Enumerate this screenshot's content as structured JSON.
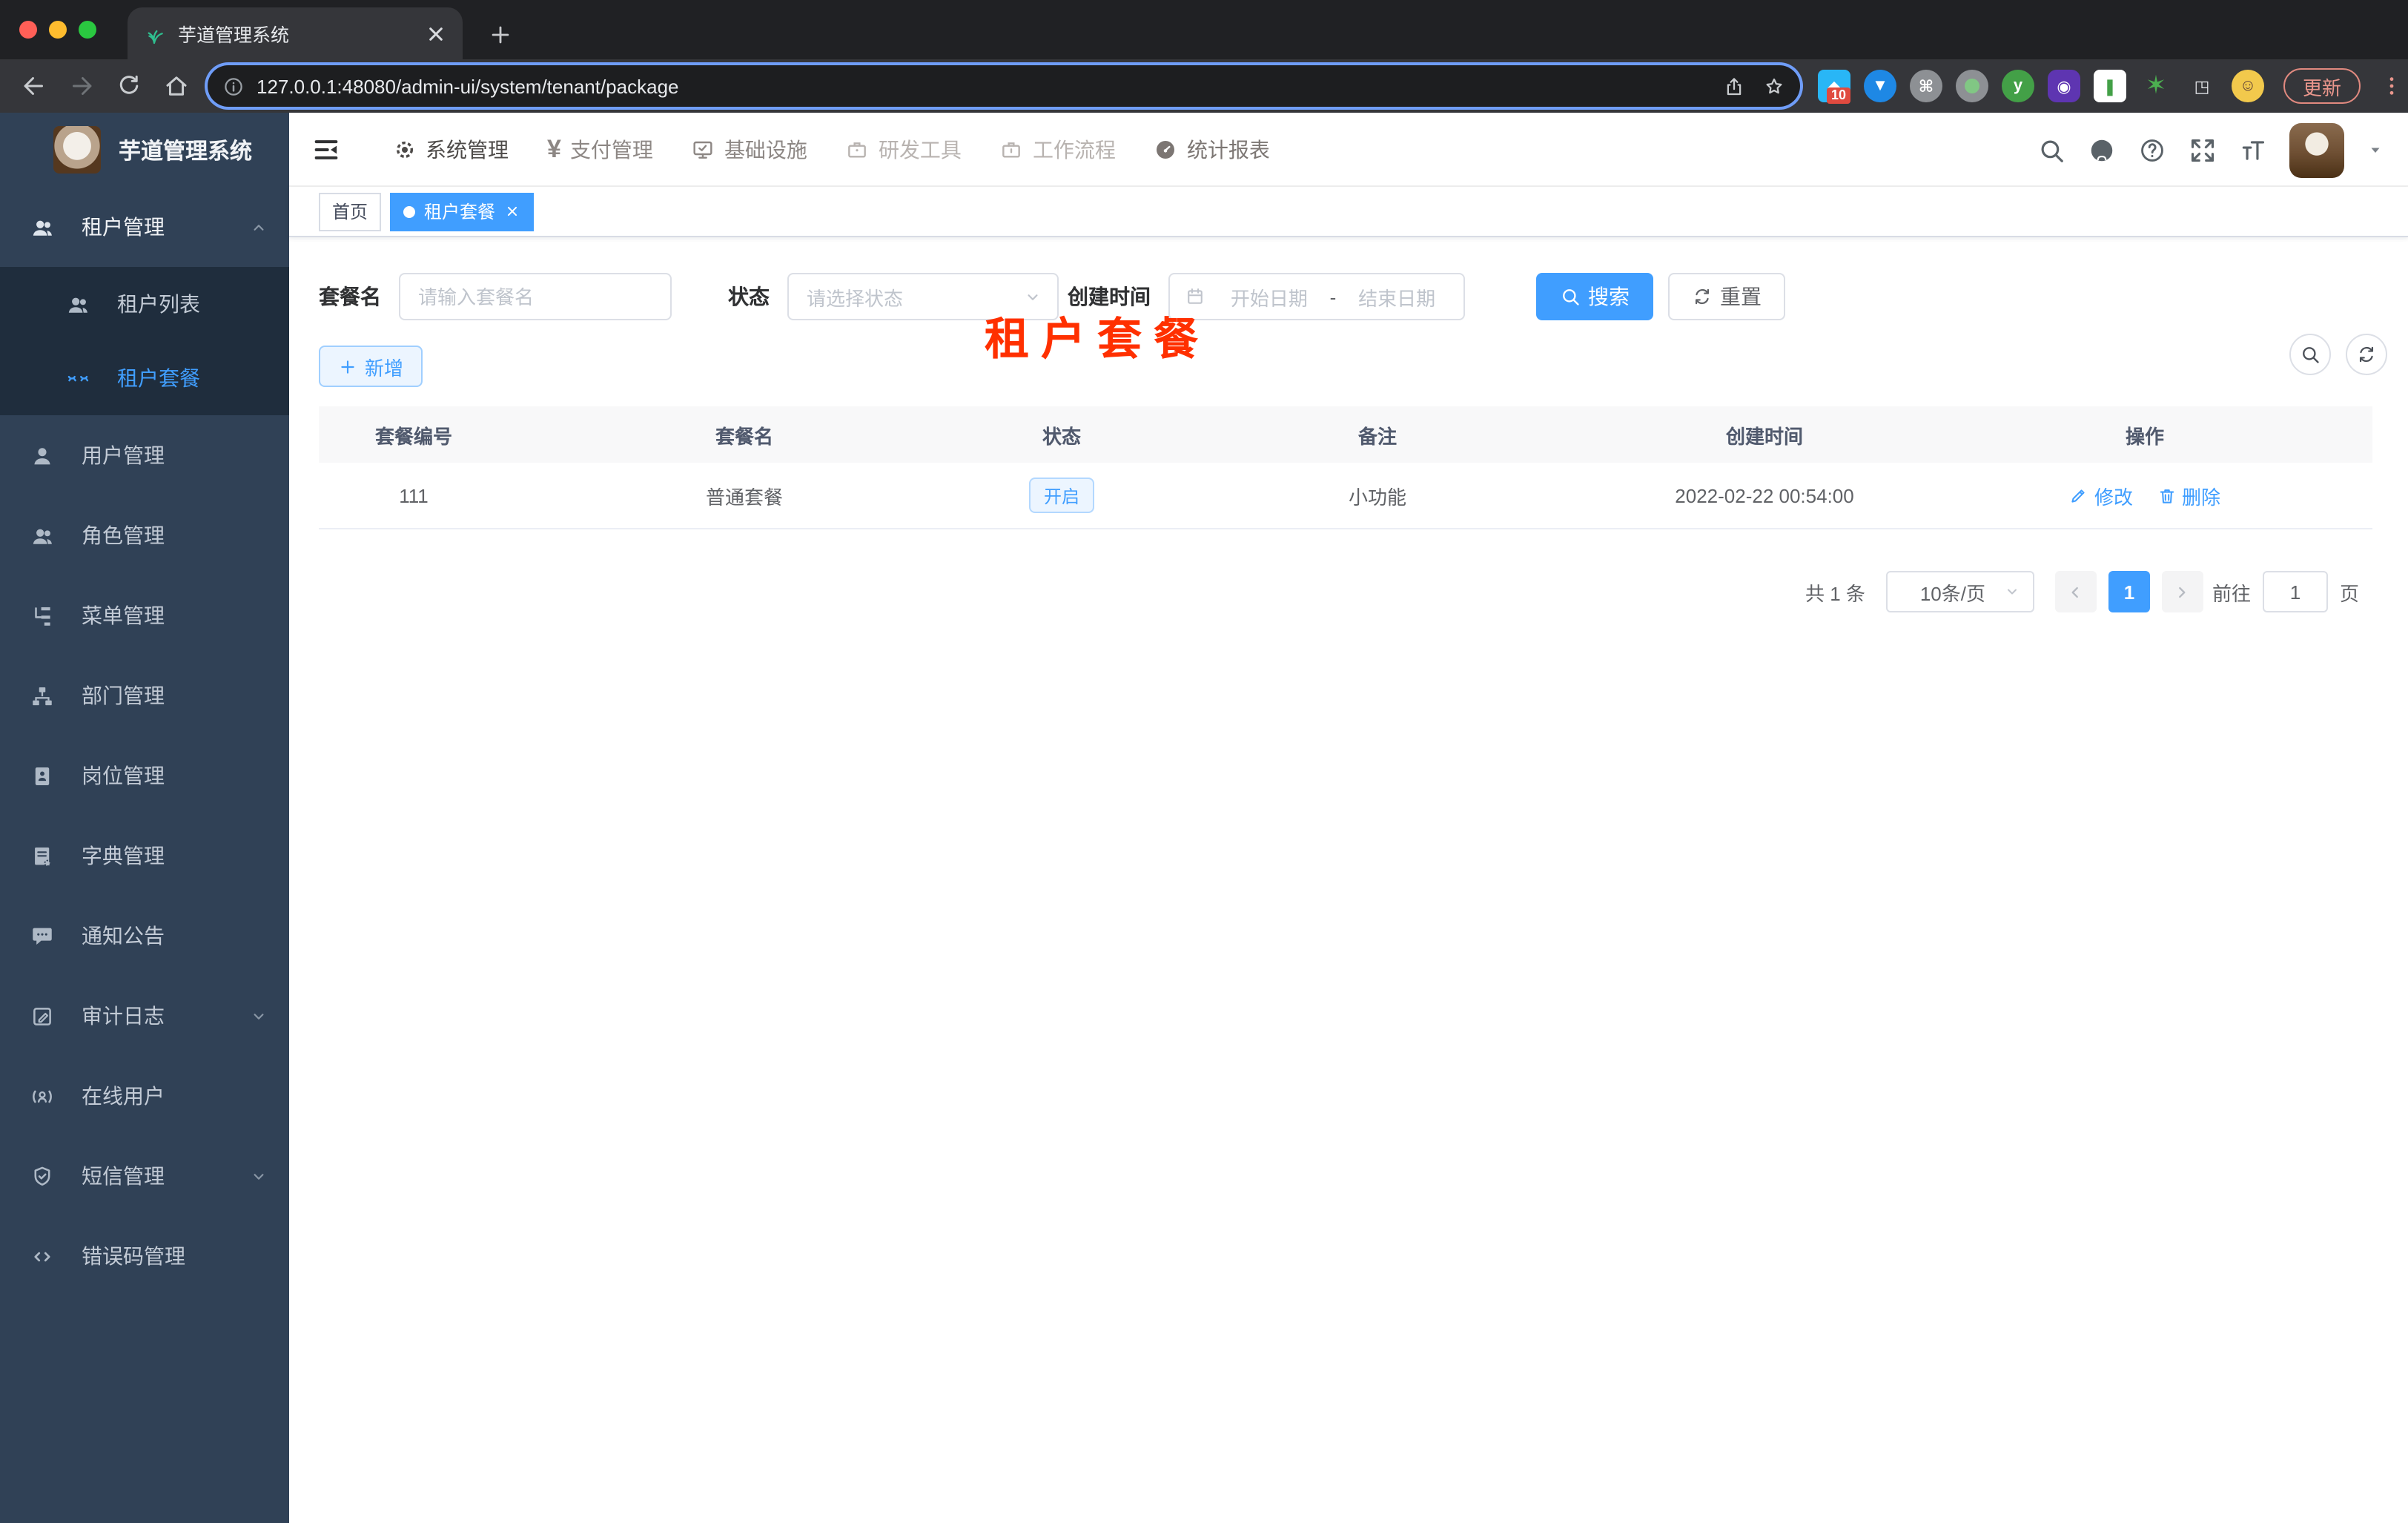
{
  "colors": {
    "accent": "#409eff",
    "sidebar_bg": "#304156",
    "submenu_bg": "#1f2d3d",
    "watermark_red": "#ff3000",
    "status_tag_bg": "#ecf5ff"
  },
  "browser": {
    "tab_title": "芋道管理系统",
    "url": "127.0.0.1:48080/admin-ui/system/tenant/package",
    "extension_badge": "10",
    "update_label": "更新",
    "traffic_lights": [
      "close-light",
      "minimize-light",
      "zoom-light"
    ],
    "toolbar_icons": [
      "back-icon",
      "forward-icon",
      "reload-icon",
      "home-icon",
      "info-icon",
      "share-icon",
      "star-icon"
    ]
  },
  "app": {
    "logo_title": "芋道管理系统",
    "nav": {
      "items": [
        {
          "icon": "gear",
          "label": "系统管理"
        },
        {
          "icon": "yen",
          "label": "支付管理"
        },
        {
          "icon": "monitor",
          "label": "基础设施"
        },
        {
          "icon": "toolbox",
          "label": "研发工具"
        },
        {
          "icon": "briefcase",
          "label": "工作流程"
        },
        {
          "icon": "dashboard",
          "label": "统计报表"
        }
      ],
      "right_icons": [
        "search-icon",
        "github-icon",
        "help-icon",
        "fullscreen-icon",
        "font-size-icon",
        "avatar",
        "caret-down-icon"
      ]
    },
    "sidebar": {
      "groups": [
        {
          "icon": "users",
          "label": "租户管理",
          "expanded": true,
          "children": [
            {
              "icon": "users",
              "label": "租户列表"
            },
            {
              "icon": "closed-eyes",
              "label": "租户套餐",
              "active": true
            }
          ]
        },
        {
          "icon": "user",
          "label": "用户管理"
        },
        {
          "icon": "users",
          "label": "角色管理"
        },
        {
          "icon": "tree",
          "label": "菜单管理"
        },
        {
          "icon": "org",
          "label": "部门管理"
        },
        {
          "icon": "badge",
          "label": "岗位管理"
        },
        {
          "icon": "book",
          "label": "字典管理"
        },
        {
          "icon": "chat",
          "label": "通知公告"
        },
        {
          "icon": "edit-note",
          "label": "审计日志",
          "collapsible": true
        },
        {
          "icon": "online",
          "label": "在线用户"
        },
        {
          "icon": "shield",
          "label": "短信管理",
          "collapsible": true
        },
        {
          "icon": "code",
          "label": "错误码管理"
        }
      ]
    },
    "tags": [
      {
        "label": "首页",
        "active": false
      },
      {
        "label": "租户套餐",
        "active": true
      }
    ],
    "watermark": "租户套餐",
    "filter": {
      "name_label": "套餐名",
      "name_placeholder": "请输入套餐名",
      "status_label": "状态",
      "status_placeholder": "请选择状态",
      "time_label": "创建时间",
      "start_placeholder": "开始日期",
      "range_separator": "-",
      "end_placeholder": "结束日期",
      "search_label": "搜索",
      "reset_label": "重置"
    },
    "toolbar": {
      "add_label": "新增",
      "mini_icons": [
        "search-icon",
        "refresh-icon"
      ]
    },
    "table": {
      "headers": [
        "套餐编号",
        "套餐名",
        "状态",
        "备注",
        "创建时间",
        "操作"
      ],
      "rows": [
        {
          "id": "111",
          "name": "普通套餐",
          "status": "开启",
          "remark": "小功能",
          "created_at": "2022-02-22 00:54:00",
          "edit_label": "修改",
          "delete_label": "删除"
        }
      ]
    },
    "pagination": {
      "total_label": "共 1 条",
      "page_size_label": "10条/页",
      "current_page": "1",
      "goto_label": "前往",
      "goto_value": "1",
      "unit_label": "页"
    }
  }
}
